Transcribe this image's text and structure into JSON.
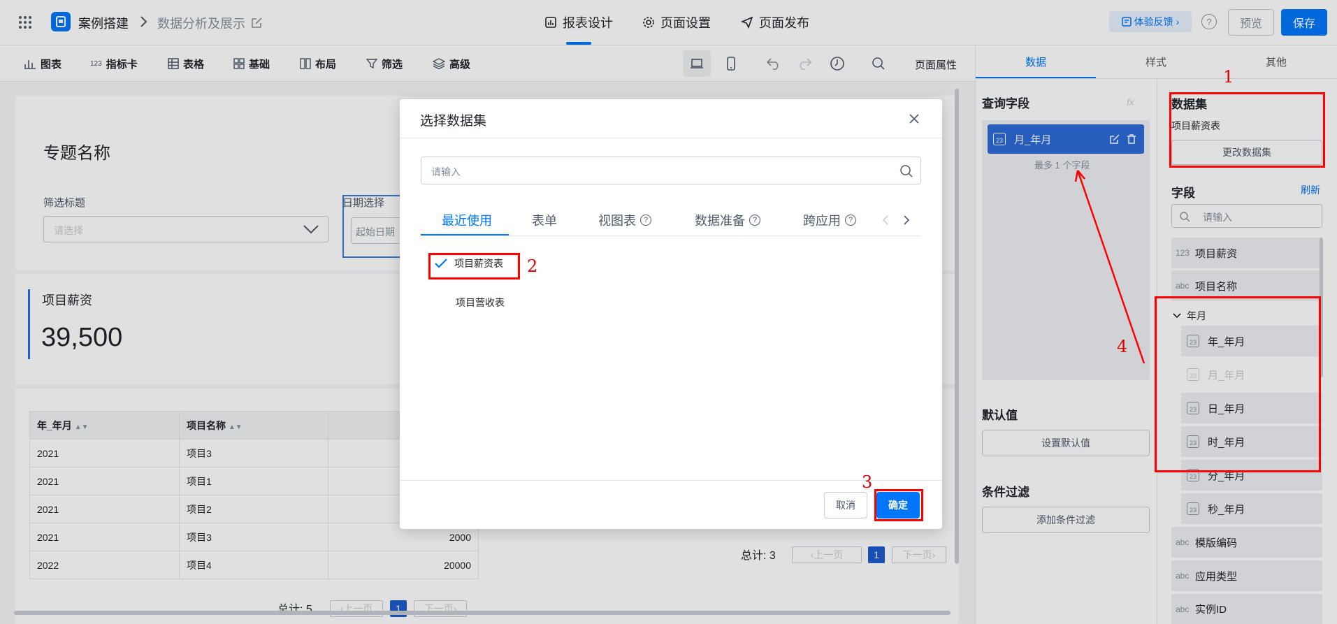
{
  "header": {
    "app_name": "案例搭建",
    "page_name": "数据分析及展示",
    "nav": [
      "报表设计",
      "页面设置",
      "页面发布"
    ],
    "feedback": "体验反馈",
    "preview": "预览",
    "save": "保存"
  },
  "toolbar": {
    "items": [
      "图表",
      "指标卡",
      "表格",
      "基础",
      "布局",
      "筛选",
      "高级"
    ],
    "indicator_prefix": "123",
    "page_props": "页面属性"
  },
  "canvas": {
    "title": "专题名称",
    "filter_label": "筛选标题",
    "filter_placeholder": "请选择",
    "date_label": "日期选择",
    "date_placeholder": "起始日期",
    "kpi_label": "项目薪资",
    "kpi_value": "39,500",
    "table": {
      "headers": [
        "年_年月",
        "项目名称"
      ],
      "rows": [
        [
          "2021",
          "项目3",
          ""
        ],
        [
          "2021",
          "项目1",
          ""
        ],
        [
          "2021",
          "项目2",
          ""
        ],
        [
          "2021",
          "项目3",
          "2000"
        ],
        [
          "2022",
          "项目4",
          "20000"
        ]
      ],
      "total": "总计: 5",
      "prev": "上一页",
      "next": "下一页",
      "page": "1"
    },
    "pager2": {
      "total": "总计: 3",
      "prev": "上一页",
      "next": "下一页",
      "page": "1"
    }
  },
  "right_panel": {
    "tabs": [
      "数据",
      "样式",
      "其他"
    ],
    "query_fields_title": "查询字段",
    "fx": "fx",
    "selected_field": "月_年月",
    "max_hint": "最多 1 个字段",
    "default_title": "默认值",
    "default_button": "设置默认值",
    "filter_title": "条件过滤",
    "filter_button": "添加条件过滤",
    "dataset_title": "数据集",
    "dataset_name": "项目薪资表",
    "change_dataset": "更改数据集",
    "fields_title": "字段",
    "refresh": "刷新",
    "search_placeholder": "请输入",
    "fields": [
      {
        "type": "123",
        "name": "项目薪资"
      },
      {
        "type": "abc",
        "name": "项目名称"
      }
    ],
    "group": "年月",
    "group_items": [
      "年_年月",
      "月_年月",
      "日_年月",
      "时_年月",
      "分_年月",
      "秒_年月"
    ],
    "more_fields": [
      {
        "type": "abc",
        "name": "模版编码"
      },
      {
        "type": "abc",
        "name": "应用类型"
      },
      {
        "type": "abc",
        "name": "实例ID"
      }
    ]
  },
  "modal": {
    "title": "选择数据集",
    "search_placeholder": "请输入",
    "tabs": [
      "最近使用",
      "表单",
      "视图表",
      "数据准备",
      "跨应用"
    ],
    "items": [
      "项目薪资表",
      "项目营收表"
    ],
    "cancel": "取消",
    "confirm": "确定"
  },
  "annotations": [
    "1",
    "2",
    "3",
    "4"
  ],
  "colors": {
    "primary": "#0077fa",
    "annotation": "#ff0000"
  }
}
